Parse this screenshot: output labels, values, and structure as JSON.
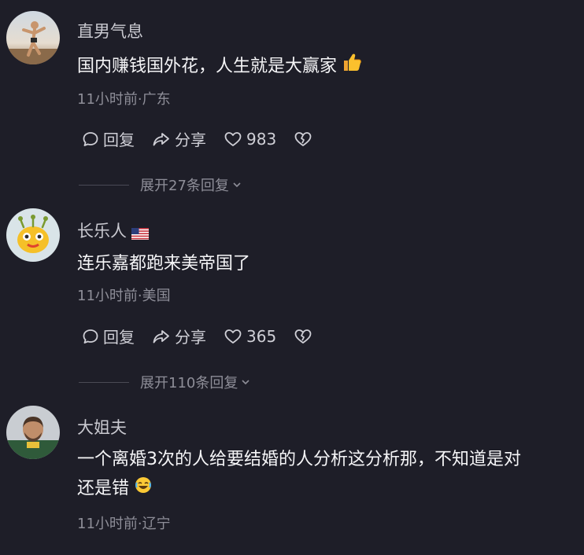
{
  "comments": [
    {
      "username": "直男气息",
      "text_lines": [
        "国内赚钱国外花，人生就是大赢家"
      ],
      "emoji": "thumbs-up-icon",
      "meta": "11小时前·广东",
      "reply_label": "回复",
      "share_label": "分享",
      "likes": "983",
      "expand_label": "展开27条回复"
    },
    {
      "username": "长乐人",
      "flag": "us-flag-icon",
      "text_lines": [
        "连乐嘉都跑来美帝国了"
      ],
      "meta": "11小时前·美国",
      "reply_label": "回复",
      "share_label": "分享",
      "likes": "365",
      "expand_label": "展开110条回复"
    },
    {
      "username": "大姐夫",
      "text_lines": [
        "一个离婚3次的人给要结婚的人分析这分析那，不知道是对",
        "还是错"
      ],
      "emoji": "laughing-face-icon",
      "meta": "11小时前·辽宁"
    }
  ],
  "colors": {
    "background": "#1e1e28",
    "text": "#f5f5f7",
    "secondary": "#8e8e98",
    "username": "#c9c9d0"
  }
}
